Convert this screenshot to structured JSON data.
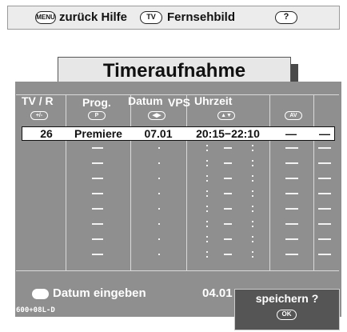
{
  "topbar": {
    "menu_key": "MENU",
    "back_help": "zurück Hilfe",
    "tv_key": "TV",
    "tv_picture": "Fernsehbild",
    "help_key": "?"
  },
  "title": "Timeraufnahme",
  "headers": {
    "tv_r": "TV / R",
    "prog": "Prog.",
    "datum": "Datum",
    "vps": "VPS",
    "uhrzeit": "Uhrzeit"
  },
  "row0": {
    "tv_r": "26",
    "prog": "Premiere",
    "datum": "07.01",
    "uhrzeit": "20:15−22:10",
    "col5": "—",
    "col6": "—"
  },
  "bottom": {
    "hint": "Datum eingeben",
    "date": "04.01",
    "code": "600+08L-D"
  },
  "save": {
    "label": "speichern ?",
    "ok_key": "OK"
  },
  "icons": {
    "col1": "+/-",
    "col2": "P",
    "col3": "◀▶",
    "col4": "▲▼",
    "col5": "AV"
  }
}
